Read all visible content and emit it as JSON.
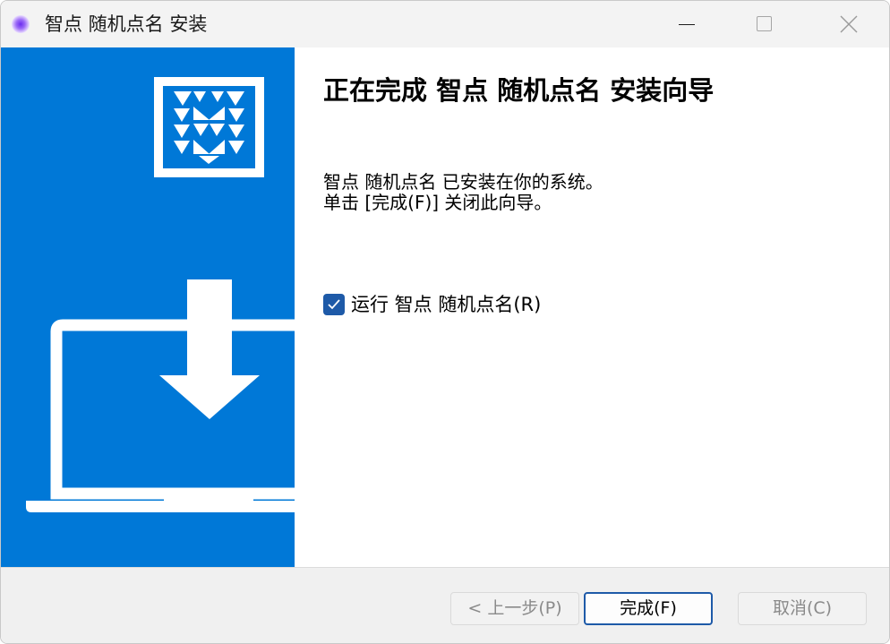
{
  "window": {
    "title": "智点 随机点名 安装",
    "controls": {
      "minimize_icon": "minimize-icon",
      "maximize_icon": "maximize-icon",
      "close_icon": "close-icon"
    }
  },
  "sidebar": {
    "background": "#0078d7",
    "logo_icon": "app-logo-icon",
    "art_icon": "laptop-download-icon"
  },
  "content": {
    "heading": "正在完成 智点 随机点名 安装向导",
    "line1": "智点 随机点名 已安装在你的系统。",
    "line2": "单击 [完成(F)] 关闭此向导。",
    "run_checkbox": {
      "label": "运行 智点 随机点名(R)",
      "checked": true
    }
  },
  "footer": {
    "back_button": "< 上一步(P)",
    "finish_button": "完成(F)",
    "cancel_button": "取消(C)"
  },
  "colors": {
    "accent": "#1e5aa8",
    "sidebar_blue": "#0078d7",
    "footer_bg": "#f0f0f0"
  }
}
